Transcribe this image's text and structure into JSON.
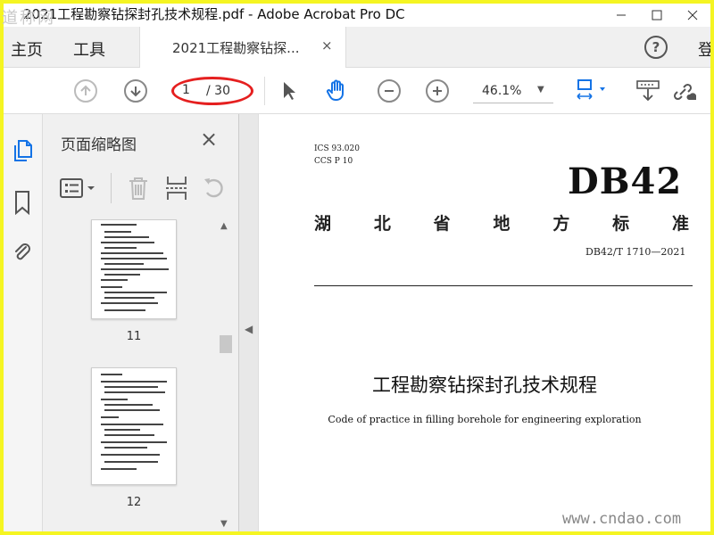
{
  "window": {
    "title": "2021工程勘察钻探封孔技术规程.pdf - Adobe Acrobat Pro DC",
    "watermark_top": "道称网"
  },
  "menubar": {
    "home": "主页",
    "tools": "工具",
    "tab_label": "2021工程勘察钻探...",
    "tab_close": "×",
    "help": "?",
    "login": "登"
  },
  "toolbar": {
    "page_current": "1",
    "page_total": "/ 30",
    "zoom": "46.1%"
  },
  "thumbnails": {
    "title": "页面缩略图",
    "close": "×",
    "items": [
      {
        "label": "11"
      },
      {
        "label": "12"
      }
    ]
  },
  "document": {
    "ics": "ICS 93.020",
    "ccs": "CCS P 10",
    "db_code": "DB42",
    "region_chars": [
      "湖",
      "北",
      "省",
      "地",
      "方",
      "标",
      "准"
    ],
    "standard_number": "DB42/T 1710—2021",
    "title_cn": "工程勘察钻探封孔技术规程",
    "title_en": "Code of practice in filling borehole for engineering exploration"
  },
  "watermark_bottom": "www.cndao.com",
  "colors": {
    "border": "#f5f522",
    "annotation": "#e51f1f",
    "accent": "#1473e6"
  }
}
